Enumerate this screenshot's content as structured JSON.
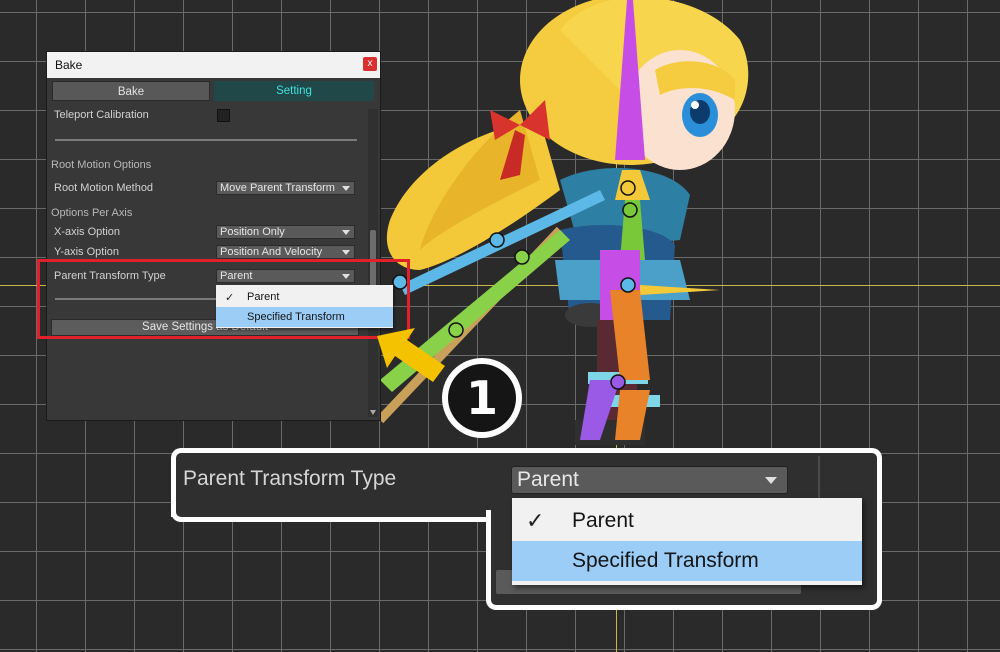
{
  "window": {
    "title": "Bake",
    "close_glyph": "x",
    "tabs": [
      {
        "label": "Bake",
        "active": false
      },
      {
        "label": "Setting",
        "active": true
      }
    ]
  },
  "settings": {
    "teleport_calibration": "Teleport Calibration",
    "root_motion_header": "Root Motion Options",
    "root_motion_method_label": "Root Motion Method",
    "root_motion_method_value": "Move Parent Transform",
    "options_per_axis_header": "Options Per Axis",
    "x_axis_label": "X-axis Option",
    "x_axis_value": "Position Only",
    "y_axis_label": "Y-axis Option",
    "y_axis_value": "Position And Velocity",
    "parent_transform_label": "Parent Transform Type",
    "parent_transform_value": "Parent",
    "save_button": "Save Settings as Default"
  },
  "dropdown_popup": {
    "items": [
      {
        "label": "Parent",
        "checked": true,
        "highlighted": false
      },
      {
        "label": "Specified Transform",
        "checked": false,
        "highlighted": true
      }
    ]
  },
  "callout": {
    "step_number": "1",
    "zoom_label": "Parent Transform Type",
    "zoom_value": "Parent",
    "zoom_items": [
      "Parent",
      "Specified Transform"
    ]
  },
  "colors": {
    "accent_tab_text": "#3fe0e0",
    "highlight_box": "#e0202a",
    "arrow": "#f5c200",
    "selected_item": "#9bcdf6"
  }
}
